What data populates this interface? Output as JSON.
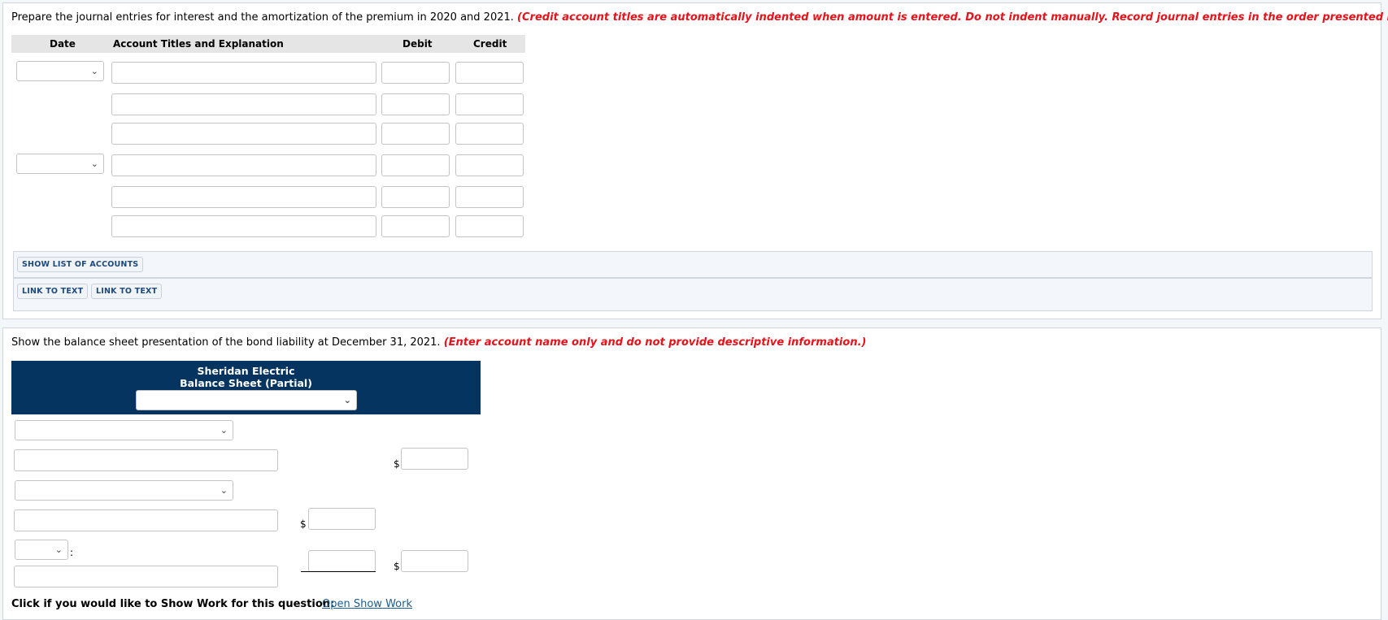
{
  "journal_section": {
    "instruction": "Prepare the journal entries for interest and the amortization of the premium in 2020 and 2021.",
    "instruction_note": "(Credit account titles are automatically indented when amount is entered. Do not indent manually. Record journal entries in the order presented in the problem.)",
    "columns": {
      "date": "Date",
      "account": "Account Titles and Explanation",
      "debit": "Debit",
      "credit": "Credit"
    },
    "entries": [
      {
        "date_selected": "",
        "rows": [
          {
            "account": "",
            "debit": "",
            "credit": ""
          },
          {
            "account": "",
            "debit": "",
            "credit": ""
          },
          {
            "account": "",
            "debit": "",
            "credit": ""
          }
        ]
      },
      {
        "date_selected": "",
        "rows": [
          {
            "account": "",
            "debit": "",
            "credit": ""
          },
          {
            "account": "",
            "debit": "",
            "credit": ""
          },
          {
            "account": "",
            "debit": "",
            "credit": ""
          }
        ]
      }
    ],
    "buttons": {
      "show_list": "SHOW LIST OF ACCOUNTS",
      "link_text_1": "LINK TO TEXT",
      "link_text_2": "LINK TO TEXT"
    }
  },
  "balance_section": {
    "instruction": "Show the balance sheet presentation of the bond liability at December 31, 2021.",
    "instruction_note": "(Enter account name only and do not provide descriptive information.)",
    "header": {
      "company": "Sheridan Electric",
      "statement": "Balance Sheet (Partial)",
      "date_selected": ""
    },
    "currency_symbol": "$",
    "colon": ":",
    "fields": {
      "category_select_1": "",
      "account_1": "",
      "amount_1": "",
      "category_select_2": "",
      "account_2": "",
      "amount_2": "",
      "small_select": "",
      "account_3": "",
      "amount_3": "",
      "total": ""
    }
  },
  "show_work": {
    "label": "Click if you would like to Show Work for this question:",
    "link": "Open Show Work"
  },
  "icons": {
    "chevron": "⌄"
  }
}
